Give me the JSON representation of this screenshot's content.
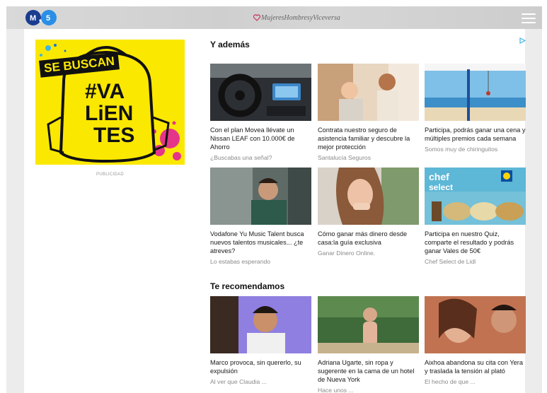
{
  "header": {
    "left_logo_text": "M.5",
    "center_logo_text": "MujeresHombresyViceversa",
    "menu_icon": "hamburger-icon"
  },
  "ad": {
    "banner_text": "SE BUSCAN",
    "headline_lines": [
      "#VA",
      "LiEN",
      "TES"
    ],
    "label": "PUBLICIDAD"
  },
  "section_ademas": {
    "title": "Y además",
    "adchoices_icon": "adchoices-icon",
    "cards": [
      {
        "title": "Con el plan Movea llévate un Nissan LEAF con 10.000€ de Ahorro",
        "source": "¿Buscabas una señal?"
      },
      {
        "title": "Contrata nuestro seguro de asistencia familiar y descubre la mejor protección",
        "source": "Santalucía Seguros"
      },
      {
        "title": "Participa, podrás ganar una cena y múltiples premios cada semana",
        "source": "Somos muy de chiringuitos"
      },
      {
        "title": "Vodafone Yu Music Talent busca nuevos talentos musicales... ¿te atreves?",
        "source": "Lo estabas esperando"
      },
      {
        "title": "Cómo ganar más dinero desde casa:la guía exclusiva",
        "source": "Ganar Dinero Online."
      },
      {
        "title": "Participa en nuestro Quiz, comparte el resultado y podrás ganar Vales de 50€",
        "source": "Chef Select de Lidl"
      }
    ]
  },
  "section_recomendamos": {
    "title": "Te recomendamos",
    "cards": [
      {
        "title": "Marco provoca, sin quererlo, su expulsión",
        "source": "Al ver que Claudia ..."
      },
      {
        "title": "Adriana Ugarte, sin ropa y sugerente en la cama de un hotel de Nueva York",
        "source": "Hace unos ..."
      },
      {
        "title": "Aixhoa abandona su cita con Yera y traslada la tensión al plató",
        "source": "El hecho de que ..."
      }
    ]
  },
  "colors": {
    "ad_yellow": "#fbe800",
    "ad_magenta": "#e5358a",
    "m5_blue": "#1f6fd1",
    "header_gray": "#d3d3d3"
  }
}
